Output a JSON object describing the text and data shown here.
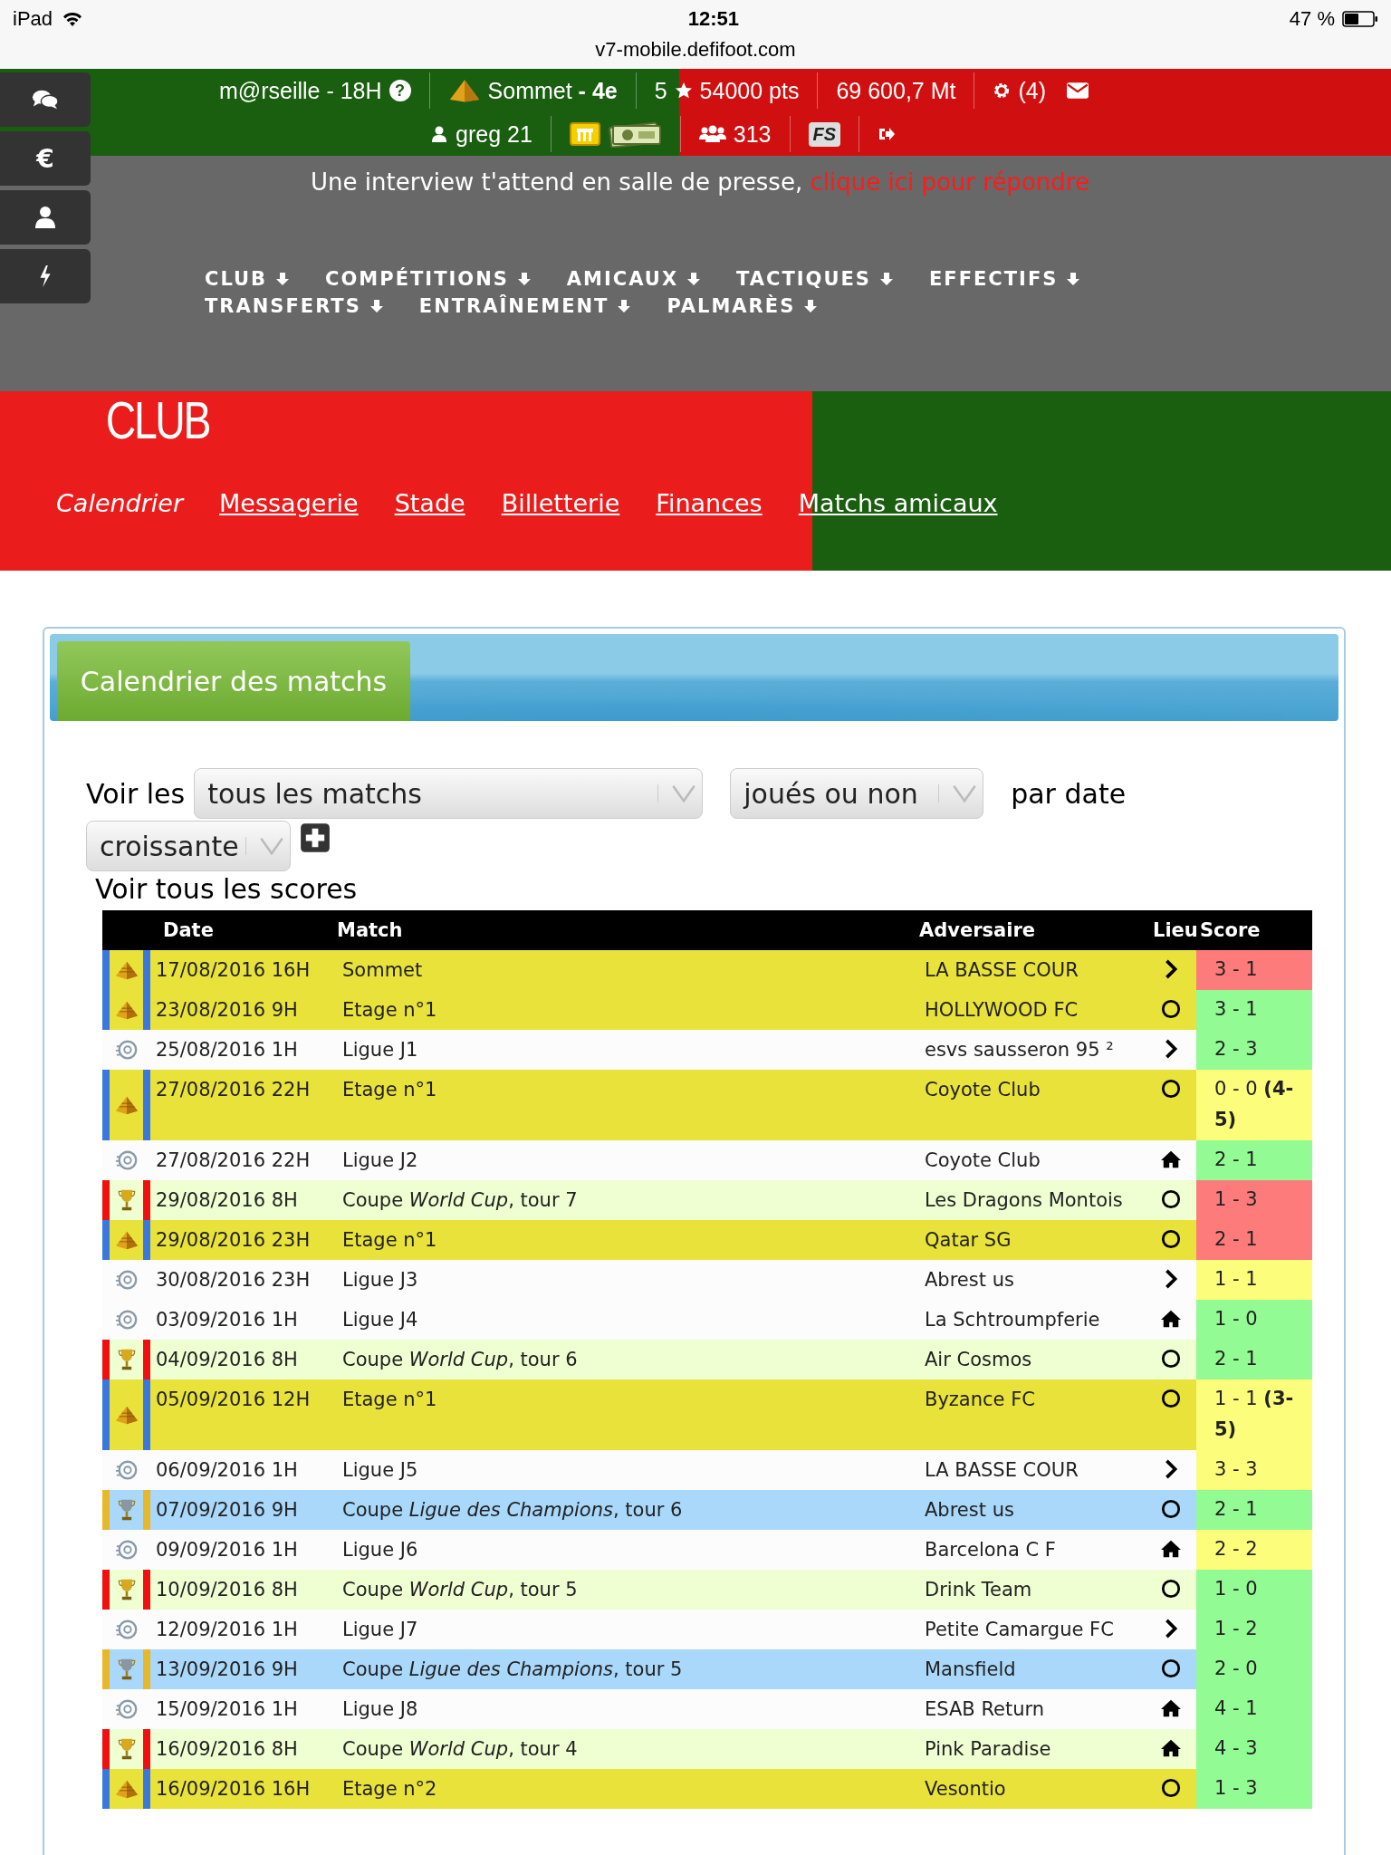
{
  "status_bar": {
    "device": "iPad",
    "time": "12:51",
    "battery": "47 %",
    "url": "v7-mobile.defifoot.com"
  },
  "side_menu": [
    {
      "kind": "chat"
    },
    {
      "kind": "money",
      "label": "€"
    },
    {
      "kind": "user"
    },
    {
      "kind": "bolt"
    }
  ],
  "top_bar": {
    "club": "m@rseille - 18H",
    "help": "?",
    "level": "Sommet **- 4e**",
    "stars": "5",
    "points": "54000 pts",
    "money": "69 600,7 Mt",
    "notifications": "(4)",
    "user": "greg 21",
    "fans": "313",
    "badge": "FS"
  },
  "notice": {
    "text": "Une interview t'attend en salle de presse,",
    "link": "clique ici pour répondre"
  },
  "menu": [
    "CLUB",
    "COMPÉTITIONS",
    "AMICAUX",
    "TACTIQUES",
    "EFFECTIFS",
    "TRANSFERTS",
    "ENTRAÎNEMENT",
    "PALMARÈS"
  ],
  "section": {
    "title": "CLUB",
    "tabs": [
      {
        "label": "Calendrier",
        "selected": true
      },
      {
        "label": "Messagerie",
        "selected": false
      },
      {
        "label": "Stade",
        "selected": false
      },
      {
        "label": "Billetterie",
        "selected": false
      },
      {
        "label": "Finances",
        "selected": false
      },
      {
        "label": "Matchs amicaux",
        "selected": false
      }
    ]
  },
  "calendar": {
    "title": "Calendrier des matchs",
    "filters": {
      "label_before": "Voir les",
      "which": "tous les matchs",
      "played": "joués ou non",
      "label_after": "par date",
      "order": "croissante"
    },
    "scores_link": "Voir tous les scores",
    "columns": [
      "Date",
      "Match",
      "Adversaire",
      "Lieu",
      "Score"
    ],
    "rows": [
      {
        "kind": "pyramid",
        "date": "17/08/2016 16H",
        "match": "Sommet",
        "opponent": "LA BASSE COUR",
        "venue": {
          "kind": "away"
        },
        "score": {
          "text": "3 - 1",
          "color": "#fd7b7b"
        }
      },
      {
        "kind": "pyramid",
        "date": "23/08/2016 9H",
        "match": "Etage n°1",
        "opponent": "HOLLYWOOD FC",
        "venue": {
          "kind": "neutral"
        },
        "score": {
          "text": "3 - 1",
          "color": "#93fb93"
        }
      },
      {
        "kind": "league",
        "date": "25/08/2016 1H",
        "match": "Ligue J1",
        "opponent": "esvs sausseron 95 ²",
        "venue": {
          "kind": "away"
        },
        "score": {
          "text": "2 - 3",
          "color": "#93fb93"
        }
      },
      {
        "kind": "pyramid",
        "date": "27/08/2016 22H",
        "match": "Etage n°1",
        "opponent": "Coyote Club",
        "venue": {
          "kind": "neutral"
        },
        "score": {
          "text": "0 - 0 **(4-5)**",
          "color": "#fdfd7c"
        }
      },
      {
        "kind": "league",
        "date": "27/08/2016 22H",
        "match": "Ligue J2",
        "opponent": "Coyote Club",
        "venue": {
          "kind": "home"
        },
        "score": {
          "text": "2 - 1",
          "color": "#93fb93"
        }
      },
      {
        "kind": "world",
        "date": "29/08/2016 8H",
        "match": "Coupe *World Cup*, tour 7",
        "opponent": "Les Dragons Montois",
        "venue": {
          "kind": "neutral"
        },
        "score": {
          "text": "1 - 3",
          "color": "#fd7b7b"
        }
      },
      {
        "kind": "pyramid",
        "date": "29/08/2016 23H",
        "match": "Etage n°1",
        "opponent": "Qatar SG",
        "venue": {
          "kind": "neutral"
        },
        "score": {
          "text": "2 - 1",
          "color": "#fd7b7b"
        }
      },
      {
        "kind": "league",
        "date": "30/08/2016 23H",
        "match": "Ligue J3",
        "opponent": "Abrest us",
        "venue": {
          "kind": "away"
        },
        "score": {
          "text": "1 - 1",
          "color": "#fdfd7c"
        }
      },
      {
        "kind": "league",
        "date": "03/09/2016 1H",
        "match": "Ligue J4",
        "opponent": "La Schtroumpferie",
        "venue": {
          "kind": "home"
        },
        "score": {
          "text": "1 - 0",
          "color": "#93fb93"
        }
      },
      {
        "kind": "world",
        "date": "04/09/2016 8H",
        "match": "Coupe *World Cup*, tour 6",
        "opponent": "Air Cosmos",
        "venue": {
          "kind": "neutral"
        },
        "score": {
          "text": "2 - 1",
          "color": "#93fb93"
        }
      },
      {
        "kind": "pyramid",
        "date": "05/09/2016 12H",
        "match": "Etage n°1",
        "opponent": "Byzance FC",
        "venue": {
          "kind": "neutral"
        },
        "score": {
          "text": "1 - 1 **(3-5)**",
          "color": "#fdfd7c"
        }
      },
      {
        "kind": "league",
        "date": "06/09/2016 1H",
        "match": "Ligue J5",
        "opponent": "LA BASSE COUR",
        "venue": {
          "kind": "away"
        },
        "score": {
          "text": "3 - 3",
          "color": "#fdfd7c"
        }
      },
      {
        "kind": "champions",
        "date": "07/09/2016 9H",
        "match": "Coupe *Ligue des Champions*, tour 6",
        "opponent": "Abrest us",
        "venue": {
          "kind": "neutral"
        },
        "score": {
          "text": "2 - 1",
          "color": "#93fb93"
        }
      },
      {
        "kind": "league",
        "date": "09/09/2016 1H",
        "match": "Ligue J6",
        "opponent": "Barcelona C F",
        "venue": {
          "kind": "home"
        },
        "score": {
          "text": "2 - 2",
          "color": "#fdfd7c"
        }
      },
      {
        "kind": "world",
        "date": "10/09/2016 8H",
        "match": "Coupe *World Cup*, tour 5",
        "opponent": "Drink Team",
        "venue": {
          "kind": "neutral"
        },
        "score": {
          "text": "1 - 0",
          "color": "#93fb93"
        }
      },
      {
        "kind": "league",
        "date": "12/09/2016 1H",
        "match": "Ligue J7",
        "opponent": "Petite Camargue FC",
        "venue": {
          "kind": "away"
        },
        "score": {
          "text": "1 - 2",
          "color": "#93fb93"
        }
      },
      {
        "kind": "champions",
        "date": "13/09/2016 9H",
        "match": "Coupe *Ligue des Champions*, tour 5",
        "opponent": "Mansfield",
        "venue": {
          "kind": "neutral"
        },
        "score": {
          "text": "2 - 0",
          "color": "#93fb93"
        }
      },
      {
        "kind": "league",
        "date": "15/09/2016 1H",
        "match": "Ligue J8",
        "opponent": "ESAB Return",
        "venue": {
          "kind": "home"
        },
        "score": {
          "text": "4 - 1",
          "color": "#93fb93"
        }
      },
      {
        "kind": "world",
        "date": "16/09/2016 8H",
        "match": "Coupe *World Cup*, tour 4",
        "opponent": "Pink Paradise",
        "venue": {
          "kind": "home"
        },
        "score": {
          "text": "4 - 3",
          "color": "#93fb93"
        }
      },
      {
        "kind": "pyramid",
        "date": "16/09/2016 16H",
        "match": "Etage n°2",
        "opponent": "Vesontio",
        "venue": {
          "kind": "neutral"
        },
        "score": {
          "text": "1 - 3",
          "color": "#93fb93"
        }
      }
    ]
  }
}
